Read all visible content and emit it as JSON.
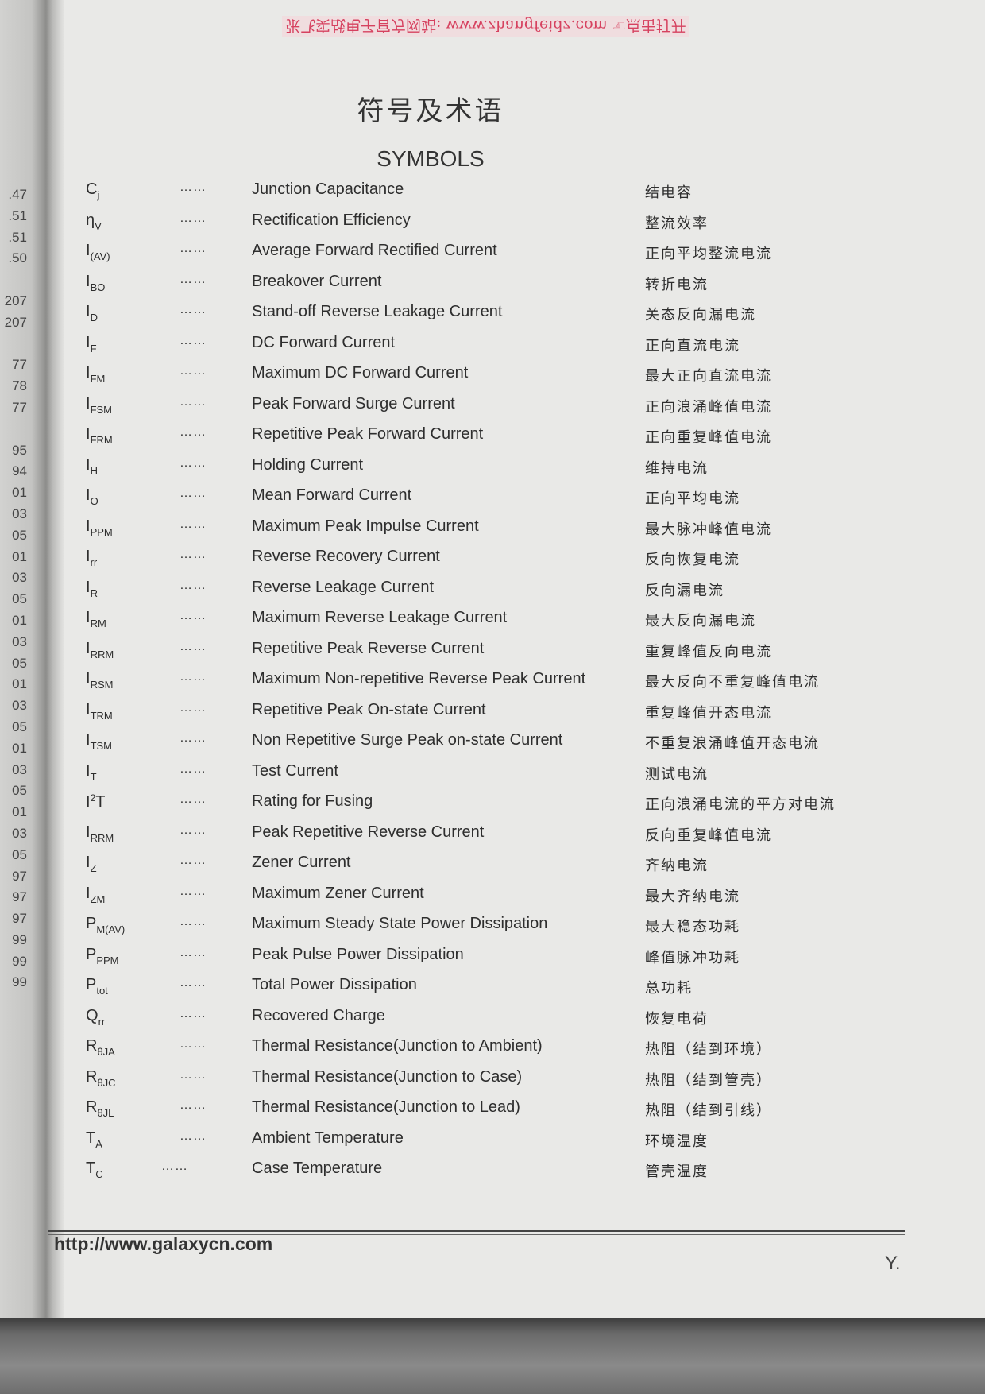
{
  "watermark_top": "张飞实战电子官方网站: www.zhangfeidz.com ☜点击打开",
  "title_cn": "符号及术语",
  "title_en": "SYMBOLS",
  "margin_numbers": [
    ".47",
    ".51",
    ".51",
    ".50",
    "",
    "207",
    "207",
    "",
    "77",
    "78",
    "77",
    "",
    "95",
    "94",
    "01",
    "03",
    "05",
    "01",
    "03",
    "05",
    "01",
    "03",
    "05",
    "01",
    "03",
    "05",
    "01",
    "03",
    "05",
    "01",
    "03",
    "05",
    "97",
    "97",
    "97",
    "99",
    "99",
    "99"
  ],
  "dots": "……",
  "symbols": [
    {
      "base": "C",
      "sub": "j",
      "en": "Junction Capacitance",
      "cn": "结电容"
    },
    {
      "base": "η",
      "sub": "V",
      "en": "Rectification Efficiency",
      "cn": "整流效率"
    },
    {
      "base": "I",
      "sub": "(AV)",
      "en": "Average Forward Rectified Current",
      "cn": "正向平均整流电流"
    },
    {
      "base": "I",
      "sub": "BO",
      "en": "Breakover Current",
      "cn": "转折电流"
    },
    {
      "base": "I",
      "sub": "D",
      "en": "Stand-off Reverse Leakage Current",
      "cn": "关态反向漏电流"
    },
    {
      "base": "I",
      "sub": "F",
      "en": "DC Forward Current",
      "cn": "正向直流电流"
    },
    {
      "base": "I",
      "sub": "FM",
      "en": "Maximum DC Forward Current",
      "cn": "最大正向直流电流"
    },
    {
      "base": "I",
      "sub": "FSM",
      "en": "Peak Forward Surge Current",
      "cn": "正向浪涌峰值电流"
    },
    {
      "base": "I",
      "sub": "FRM",
      "en": "Repetitive Peak Forward Current",
      "cn": "正向重复峰值电流"
    },
    {
      "base": "I",
      "sub": "H",
      "en": "Holding Current",
      "cn": "维持电流"
    },
    {
      "base": "I",
      "sub": "O",
      "en": "Mean Forward Current",
      "cn": "正向平均电流"
    },
    {
      "base": "I",
      "sub": "PPM",
      "en": "Maximum Peak Impulse Current",
      "cn": "最大脉冲峰值电流"
    },
    {
      "base": "I",
      "sub": "rr",
      "en": "Reverse Recovery Current",
      "cn": "反向恢复电流"
    },
    {
      "base": "I",
      "sub": "R",
      "en": "Reverse Leakage Current",
      "cn": "反向漏电流"
    },
    {
      "base": "I",
      "sub": "RM",
      "en": "Maximum Reverse Leakage Current",
      "cn": "最大反向漏电流"
    },
    {
      "base": "I",
      "sub": "RRM",
      "en": "Repetitive Peak Reverse Current",
      "cn": "重复峰值反向电流"
    },
    {
      "base": "I",
      "sub": "RSM",
      "en": "Maximum Non-repetitive Reverse Peak Current",
      "cn": "最大反向不重复峰值电流"
    },
    {
      "base": "I",
      "sub": "TRM",
      "en": "Repetitive Peak On-state Current",
      "cn": "重复峰值开态电流"
    },
    {
      "base": "I",
      "sub": "TSM",
      "en": "Non Repetitive Surge Peak on-state Current",
      "cn": "不重复浪涌峰值开态电流"
    },
    {
      "base": "I",
      "sub": "T",
      "en": "Test Current",
      "cn": "测试电流"
    },
    {
      "base": "I",
      "sup": "2",
      "tail": "T",
      "en": "Rating for Fusing",
      "cn": "正向浪涌电流的平方对电流"
    },
    {
      "base": "I",
      "sub": "RRM",
      "en": "Peak Repetitive Reverse Current",
      "cn": "反向重复峰值电流"
    },
    {
      "base": "I",
      "sub": "Z",
      "en": "Zener Current",
      "cn": "齐纳电流"
    },
    {
      "base": "I",
      "sub": "ZM",
      "en": "Maximum Zener Current",
      "cn": "最大齐纳电流"
    },
    {
      "base": "P",
      "sub": "M(AV)",
      "en": "Maximum Steady State Power Dissipation",
      "cn": "最大稳态功耗"
    },
    {
      "base": "P",
      "sub": "PPM",
      "en": "Peak Pulse Power Dissipation",
      "cn": "峰值脉冲功耗"
    },
    {
      "base": "P",
      "sub": "tot",
      "en": "Total Power Dissipation",
      "cn": "总功耗"
    },
    {
      "base": "Q",
      "sub": "rr",
      "en": "Recovered Charge",
      "cn": "恢复电荷"
    },
    {
      "base": "R",
      "sub": "θJA",
      "en": "Thermal Resistance(Junction to Ambient)",
      "cn": "热阻（结到环境）"
    },
    {
      "base": "R",
      "sub": "θJC",
      "en": "Thermal Resistance(Junction to Case)",
      "cn": "热阻（结到管壳）"
    },
    {
      "base": "R",
      "sub": "θJL",
      "en": "Thermal Resistance(Junction to Lead)",
      "cn": "热阻（结到引线）"
    },
    {
      "base": "T",
      "sub": "A",
      "en": "Ambient Temperature",
      "cn": "环境温度"
    },
    {
      "base": "T",
      "sub": "C",
      "en": "Case Temperature",
      "cn": "管壳温度"
    }
  ],
  "footer": {
    "url": "http://www.galaxycn.com",
    "corner_mark": "Y."
  }
}
